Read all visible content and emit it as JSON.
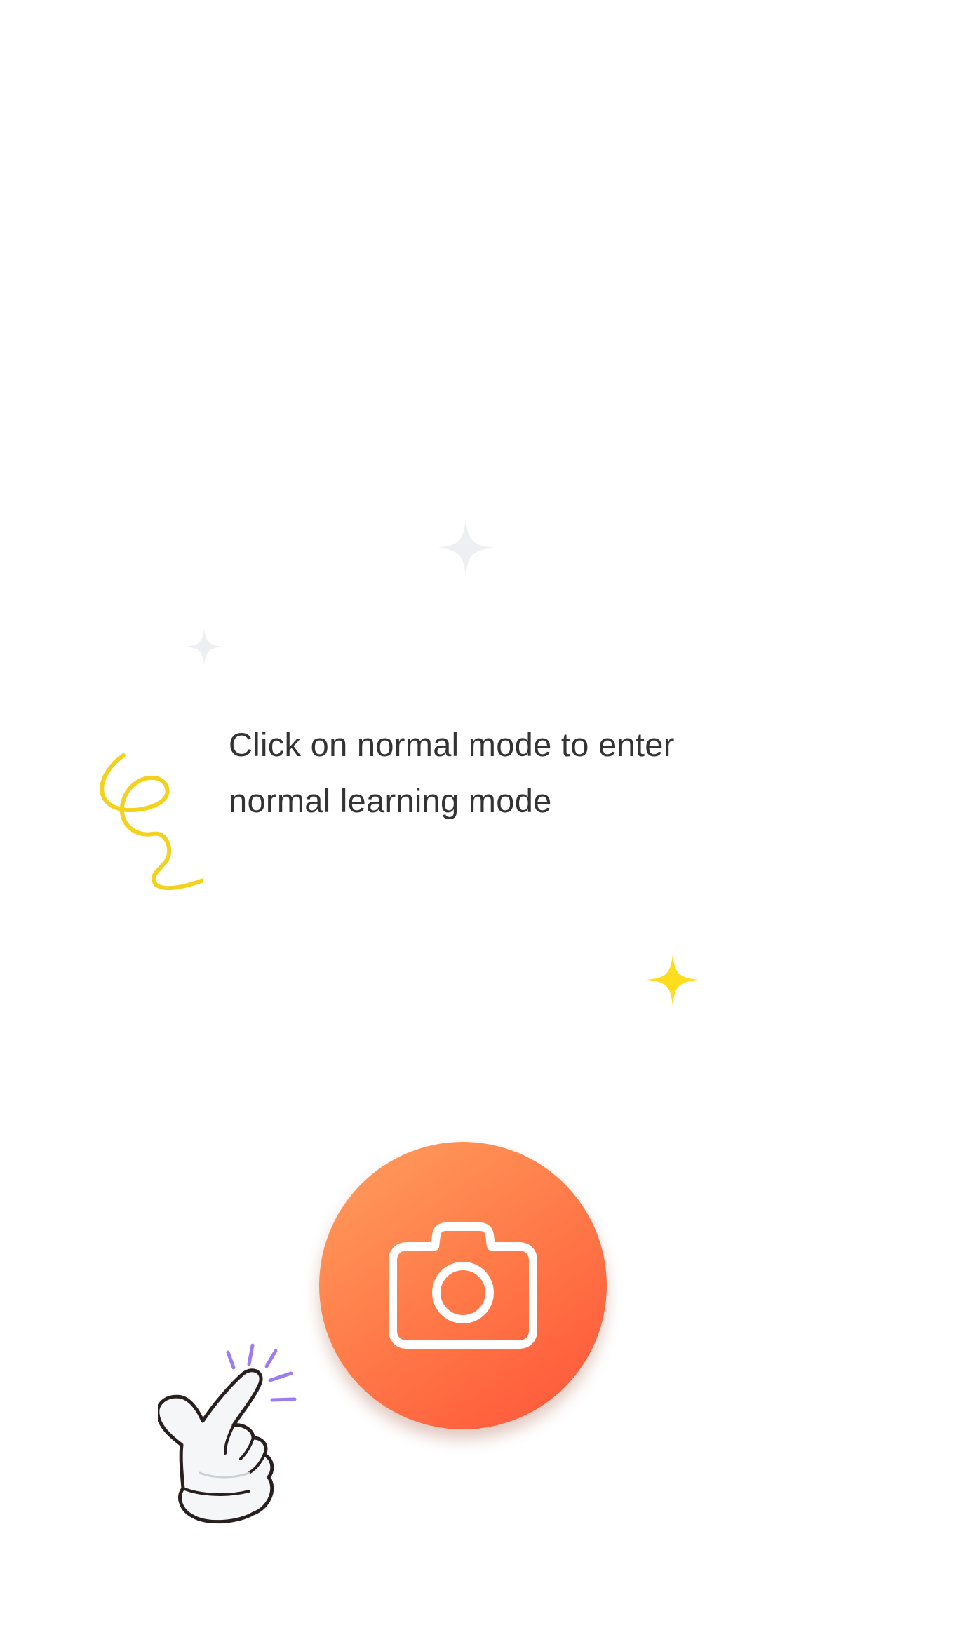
{
  "guide": {
    "text_line_1": "Click on normal mode to enter",
    "text_line_2": "normal learning mode"
  },
  "camera_button": {
    "icon": "camera-icon",
    "gradient_start": "#ff9e5e",
    "gradient_end": "#ff5338"
  },
  "decorations": {
    "sparkle_gray_color": "#eeeff2",
    "sparkle_yellow_color": "#ffdc1e",
    "swirl_color": "#f2d21c",
    "hand_icon": "pointing-hand-icon",
    "tap_lines_color": "#9d7cf3"
  }
}
